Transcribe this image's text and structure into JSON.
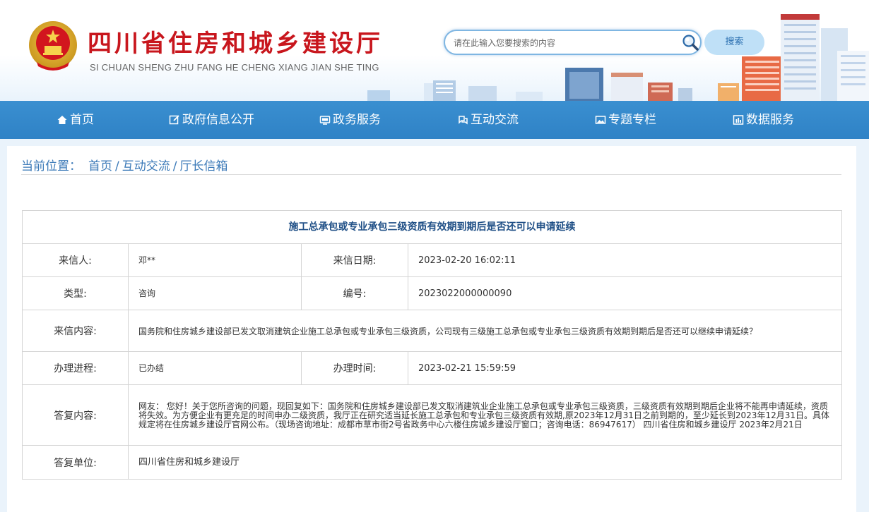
{
  "header": {
    "title": "四川省住房和城乡建设厅",
    "subtitle": "SI CHUAN SHENG ZHU FANG HE CHENG XIANG JIAN SHE TING",
    "search_placeholder": "请在此输入您要搜索的内容",
    "search_button": "搜索",
    "emblem_icon": "national-emblem-icon",
    "accent_color": "#c8161d"
  },
  "nav": {
    "items": [
      {
        "label": "首页",
        "icon": "home-icon"
      },
      {
        "label": "政府信息公开",
        "icon": "edit-icon"
      },
      {
        "label": "政务服务",
        "icon": "monitor-icon"
      },
      {
        "label": "互动交流",
        "icon": "chat-icon"
      },
      {
        "label": "专题专栏",
        "icon": "image-icon"
      },
      {
        "label": "数据服务",
        "icon": "chart-icon"
      }
    ],
    "color": "#2f82c6"
  },
  "breadcrumb": {
    "prefix": "当前位置：",
    "items": [
      "首页",
      "互动交流",
      "厅长信箱"
    ],
    "sep": "/"
  },
  "letter": {
    "title": "施工总承包或专业承包三级资质有效期到期后是否还可以申请延续",
    "sender_label": "来信人:",
    "sender": "邓**",
    "date_label": "来信日期:",
    "date": "2023-02-20 16:02:11",
    "type_label": "类型:",
    "type": "咨询",
    "number_label": "编号:",
    "number": "2023022000000090",
    "content_label": "来信内容:",
    "content": "国务院和住房城乡建设部已发文取消建筑企业施工总承包或专业承包三级资质，公司现有三级施工总承包或专业承包三级资质有效期到期后是否还可以继续申请延续？",
    "progress_label": "办理进程:",
    "progress": "已办结",
    "time_label": "办理时间:",
    "time": "2023-02-21 15:59:59",
    "reply_label": "答复内容:",
    "reply": "网友： 您好！关于您所咨询的问题，现回复如下：国务院和住房城乡建设部已发文取消建筑业企业施工总承包或专业承包三级资质，三级资质有效期到期后企业将不能再申请延续，资质将失效。为方便企业有更充足的时间申办二级资质，我厅正在研究适当延长施工总承包和专业承包三级资质有效期,原2023年12月31日之前到期的，至少延长到2023年12月31日。具体规定将在住房城乡建设厅官网公布。（现场咨询地址：成都市草市街2号省政务中心六楼住房城乡建设厅窗口；咨询电话：86947617） 四川省住房和城乡建设厅 2023年2月21日",
    "unit_label": "答复单位:",
    "unit": "四川省住房和城乡建设厅"
  }
}
